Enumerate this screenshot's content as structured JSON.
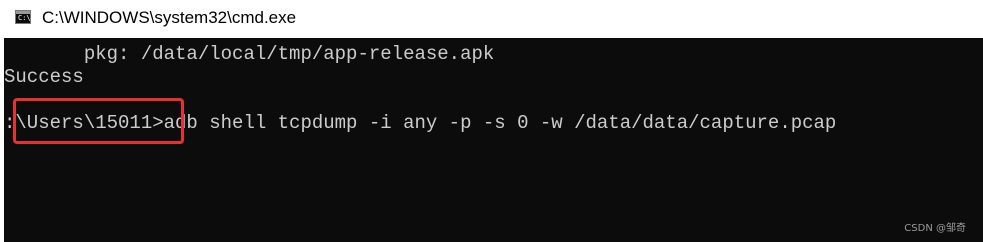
{
  "window": {
    "title": "C:\\WINDOWS\\system32\\cmd.exe",
    "icon": "cmd-icon"
  },
  "console": {
    "lines": [
      "       pkg: /data/local/tmp/app-release.apk",
      "Success",
      ":\\Users\\15011>adb shell tcpdump -i any -p -s 0 -w /data/data/capture.pcap"
    ],
    "foreground_color": "#cccccc",
    "background_color": "#0c0c0c"
  },
  "annotation": {
    "highlight_color": "#e8302d"
  },
  "watermark": "CSDN @邹奇"
}
